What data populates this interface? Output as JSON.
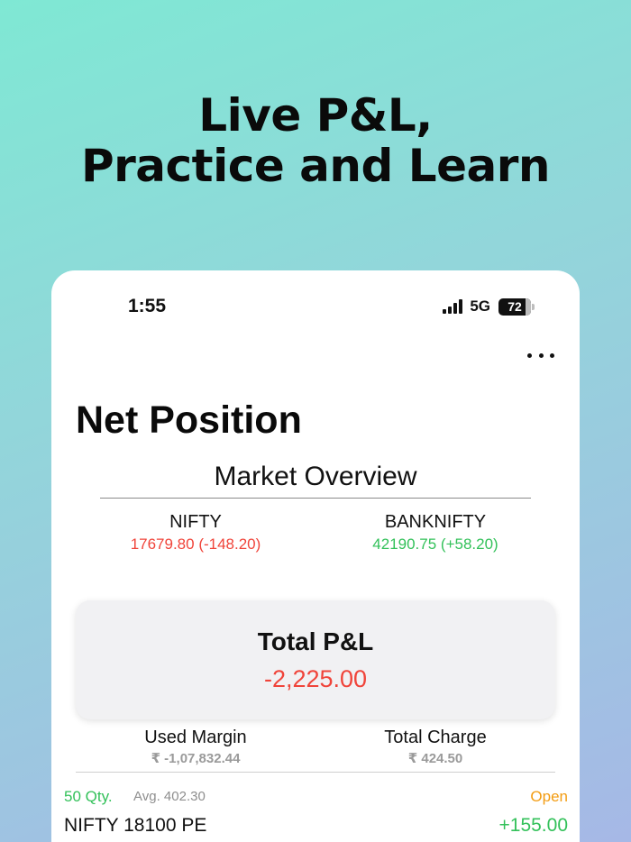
{
  "headline": {
    "line1": "Live P&L,",
    "line2": "Practice and Learn"
  },
  "status_bar": {
    "time": "1:55",
    "network": "5G",
    "battery": "72"
  },
  "page": {
    "title": "Net Position"
  },
  "market_overview": {
    "title": "Market Overview",
    "indices": [
      {
        "name": "NIFTY",
        "value": "17679.80 (-148.20)",
        "trend": "down"
      },
      {
        "name": "BANKNIFTY",
        "value": "42190.75 (+58.20)",
        "trend": "up"
      }
    ]
  },
  "total_pl": {
    "label": "Total P&L",
    "value": "-2,225.00"
  },
  "stats": {
    "used_margin_label": "Used Margin",
    "used_margin_value": "₹ -1,07,832.44",
    "total_charge_label": "Total Charge",
    "total_charge_value": "₹ 424.50"
  },
  "positions": [
    {
      "qty": "50 Qty.",
      "avg": "Avg. 402.30",
      "status": "Open",
      "symbol": "NIFTY 18100 PE",
      "pnl": "+155.00"
    }
  ],
  "colors": {
    "loss": "#f0443a",
    "profit": "#33c15a",
    "open_status": "#f39c12"
  }
}
